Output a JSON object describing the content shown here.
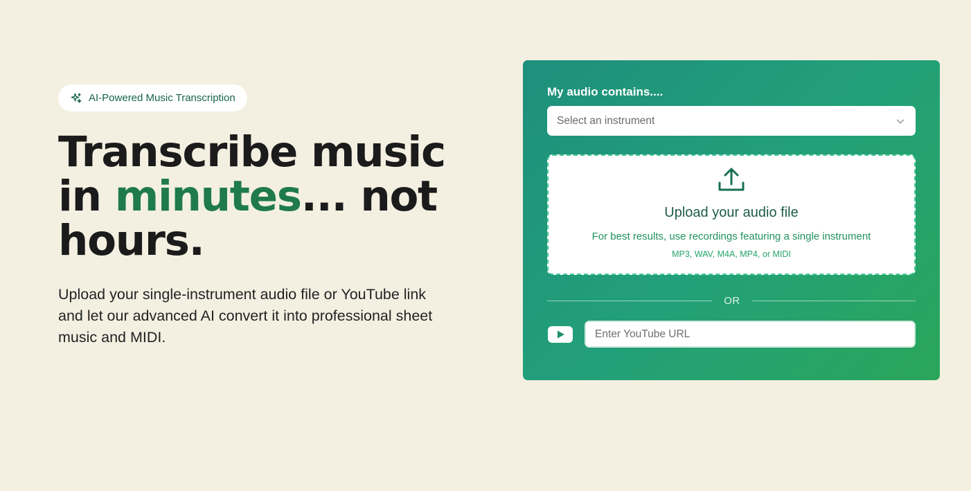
{
  "hero": {
    "badge_label": "AI-Powered Music Transcription",
    "badge_icon": "sparkle-icon",
    "headline_part1": "Transcribe music in ",
    "headline_accent": "minutes",
    "headline_part2": "... not hours.",
    "subtext": "Upload your single-instrument audio file or YouTube link and let our advanced AI convert it into professional sheet music and MIDI."
  },
  "card": {
    "label": "My audio contains....",
    "select_value": "Select an instrument",
    "select_icon": "chevron-down-icon",
    "upload": {
      "icon": "upload-icon",
      "title": "Upload your audio file",
      "hint": "For best results, use recordings featuring a single instrument",
      "formats": "MP3, WAV, M4A, MP4, or MIDI"
    },
    "divider_text": "OR",
    "youtube": {
      "icon": "youtube-icon",
      "placeholder": "Enter YouTube URL"
    }
  },
  "colors": {
    "background": "#f3f0e2",
    "accent_green": "#1f7a4c",
    "card_gradient_start": "#1e8f7c",
    "card_gradient_end": "#2aa65a",
    "dropzone_border": "#49c99a"
  }
}
